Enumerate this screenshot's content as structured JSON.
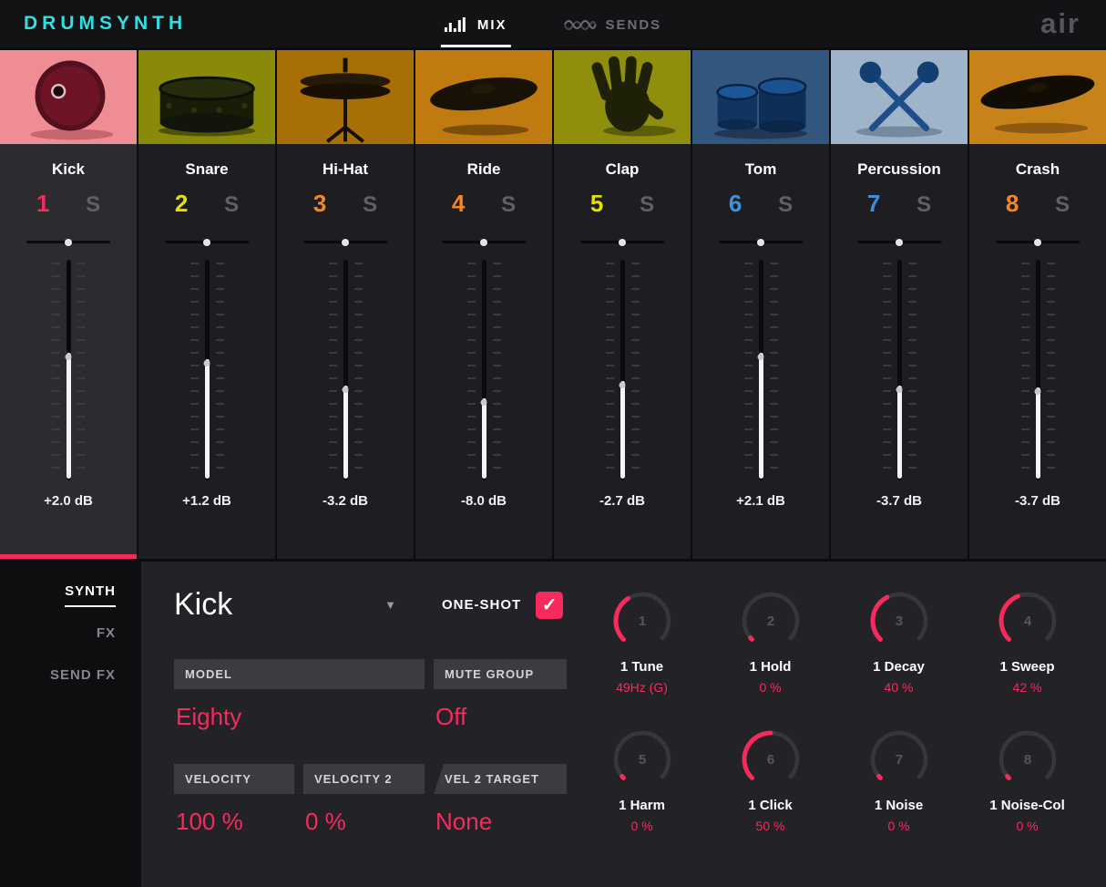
{
  "header": {
    "logo": "DRUMSYNTH",
    "brand": "air",
    "tabs": [
      {
        "label": "MIX",
        "active": true
      },
      {
        "label": "SENDS",
        "active": false
      }
    ]
  },
  "colors": {
    "accent_pink": "#f72a5e",
    "yellow": "#e3e005",
    "orange": "#f5871e",
    "blue": "#3f8fdd"
  },
  "channels": [
    {
      "name": "Kick",
      "number": "1",
      "solo": "S",
      "db": "+2.0 dB",
      "number_color": "#f72a5e",
      "thumb_bg": "#ee8e94",
      "fader": 0.42,
      "selected": true
    },
    {
      "name": "Snare",
      "number": "2",
      "solo": "S",
      "db": "+1.2 dB",
      "number_color": "#e3e005",
      "thumb_bg": "#8a8a0a",
      "fader": 0.45,
      "selected": false
    },
    {
      "name": "Hi-Hat",
      "number": "3",
      "solo": "S",
      "db": "-3.2 dB",
      "number_color": "#f5871e",
      "thumb_bg": "#a86f06",
      "fader": 0.57,
      "selected": false
    },
    {
      "name": "Ride",
      "number": "4",
      "solo": "S",
      "db": "-8.0 dB",
      "number_color": "#f5871e",
      "thumb_bg": "#c07b10",
      "fader": 0.63,
      "selected": false
    },
    {
      "name": "Clap",
      "number": "5",
      "solo": "S",
      "db": "-2.7 dB",
      "number_color": "#e3e005",
      "thumb_bg": "#8f8f0d",
      "fader": 0.55,
      "selected": false
    },
    {
      "name": "Tom",
      "number": "6",
      "solo": "S",
      "db": "+2.1 dB",
      "number_color": "#3f8fdd",
      "thumb_bg": "#33567e",
      "fader": 0.42,
      "selected": false
    },
    {
      "name": "Percussion",
      "number": "7",
      "solo": "S",
      "db": "-3.7 dB",
      "number_color": "#3f8fdd",
      "thumb_bg": "#9fb4c8",
      "fader": 0.57,
      "selected": false
    },
    {
      "name": "Crash",
      "number": "8",
      "solo": "S",
      "db": "-3.7 dB",
      "number_color": "#f5871e",
      "thumb_bg": "#c8821a",
      "fader": 0.58,
      "selected": false
    }
  ],
  "sidebar": {
    "items": [
      {
        "label": "SYNTH",
        "active": true
      },
      {
        "label": "FX",
        "active": false
      },
      {
        "label": "SEND FX",
        "active": false
      }
    ]
  },
  "editor": {
    "pad_name": "Kick",
    "one_shot_label": "ONE-SHOT",
    "one_shot_checked": true,
    "fields": [
      {
        "label": "MODEL",
        "value": "Eighty"
      },
      {
        "label": "MUTE GROUP",
        "value": "Off"
      },
      {
        "label": "VELOCITY",
        "value": "100 %"
      },
      {
        "label": "VELOCITY 2",
        "value": "0 %"
      },
      {
        "label": "VEL 2 TARGET",
        "value": "None"
      }
    ],
    "knobs": [
      {
        "num": "1",
        "label": "1 Tune",
        "value": "49Hz (G)",
        "amount": 0.38
      },
      {
        "num": "2",
        "label": "1 Hold",
        "value": "0 %",
        "amount": 0.02
      },
      {
        "num": "3",
        "label": "1 Decay",
        "value": "40 %",
        "amount": 0.4
      },
      {
        "num": "4",
        "label": "1 Sweep",
        "value": "42 %",
        "amount": 0.42
      },
      {
        "num": "5",
        "label": "1 Harm",
        "value": "0 %",
        "amount": 0.02
      },
      {
        "num": "6",
        "label": "1 Click",
        "value": "50 %",
        "amount": 0.5
      },
      {
        "num": "7",
        "label": "1 Noise",
        "value": "0 %",
        "amount": 0.02
      },
      {
        "num": "8",
        "label": "1 Noise-Col",
        "value": "0 %",
        "amount": 0.02
      }
    ]
  }
}
